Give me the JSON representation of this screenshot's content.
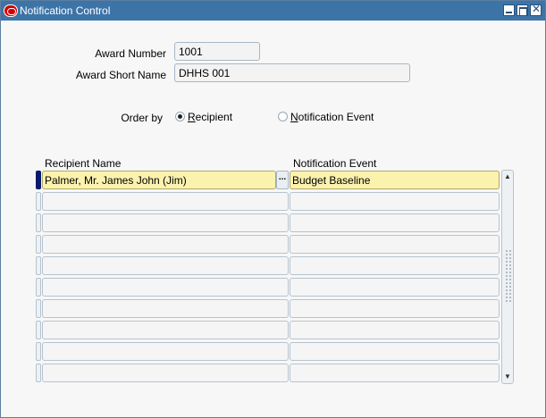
{
  "window": {
    "title": "Notification Control"
  },
  "form": {
    "award_number_label": "Award Number",
    "award_number_value": "1001",
    "award_short_name_label": "Award Short Name",
    "award_short_name_value": "DHHS 001",
    "order_by_label": "Order by",
    "order_by_options": [
      {
        "label": "Recipient",
        "mnemonic": "R",
        "selected": true
      },
      {
        "label": "Notification Event",
        "mnemonic": "N",
        "selected": false
      }
    ]
  },
  "table": {
    "columns": [
      "Recipient Name",
      "Notification Event"
    ],
    "rows": [
      {
        "recipient": "Palmer, Mr. James John (Jim)",
        "event": "Budget Baseline"
      },
      {
        "recipient": "",
        "event": ""
      },
      {
        "recipient": "",
        "event": ""
      },
      {
        "recipient": "",
        "event": ""
      },
      {
        "recipient": "",
        "event": ""
      },
      {
        "recipient": "",
        "event": ""
      },
      {
        "recipient": "",
        "event": ""
      },
      {
        "recipient": "",
        "event": ""
      },
      {
        "recipient": "",
        "event": ""
      },
      {
        "recipient": "",
        "event": ""
      }
    ],
    "lov_button": "..."
  },
  "colors": {
    "titlebar": "#3d74a8",
    "active_cell": "#fbf2ae",
    "current_row_indicator": "#0a1a6e"
  }
}
